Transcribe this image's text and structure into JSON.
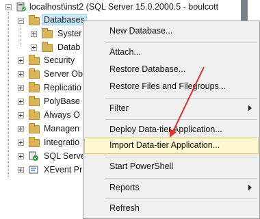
{
  "tree": {
    "server_label": "localhost\\inst2 (SQL Server 15.0.2000.5 - boulcott",
    "items": [
      {
        "label": "Databases"
      },
      {
        "label": "Syster"
      },
      {
        "label": "Datab"
      },
      {
        "label": "Security"
      },
      {
        "label": "Server Ob"
      },
      {
        "label": "Replicatio"
      },
      {
        "label": "PolyBase"
      },
      {
        "label": "Always O"
      },
      {
        "label": "Managen"
      },
      {
        "label": "Integratio"
      },
      {
        "label": "SQL Serve"
      },
      {
        "label": "XEvent Pr"
      }
    ]
  },
  "context_menu": {
    "items": [
      {
        "label": "New Database..."
      },
      {
        "label": "Attach..."
      },
      {
        "label": "Restore Database..."
      },
      {
        "label": "Restore Files and Filegroups..."
      },
      {
        "label": "Filter"
      },
      {
        "label": "Deploy Data-tier Application..."
      },
      {
        "label": "Import Data-tier Application..."
      },
      {
        "label": "Start PowerShell"
      },
      {
        "label": "Reports"
      },
      {
        "label": "Refresh"
      }
    ]
  },
  "colors": {
    "highlight_bg": "#fff7cf",
    "highlight_border": "#e5c365",
    "annotation_arrow": "#e0302a",
    "selection_bg": "#cce8ff"
  }
}
